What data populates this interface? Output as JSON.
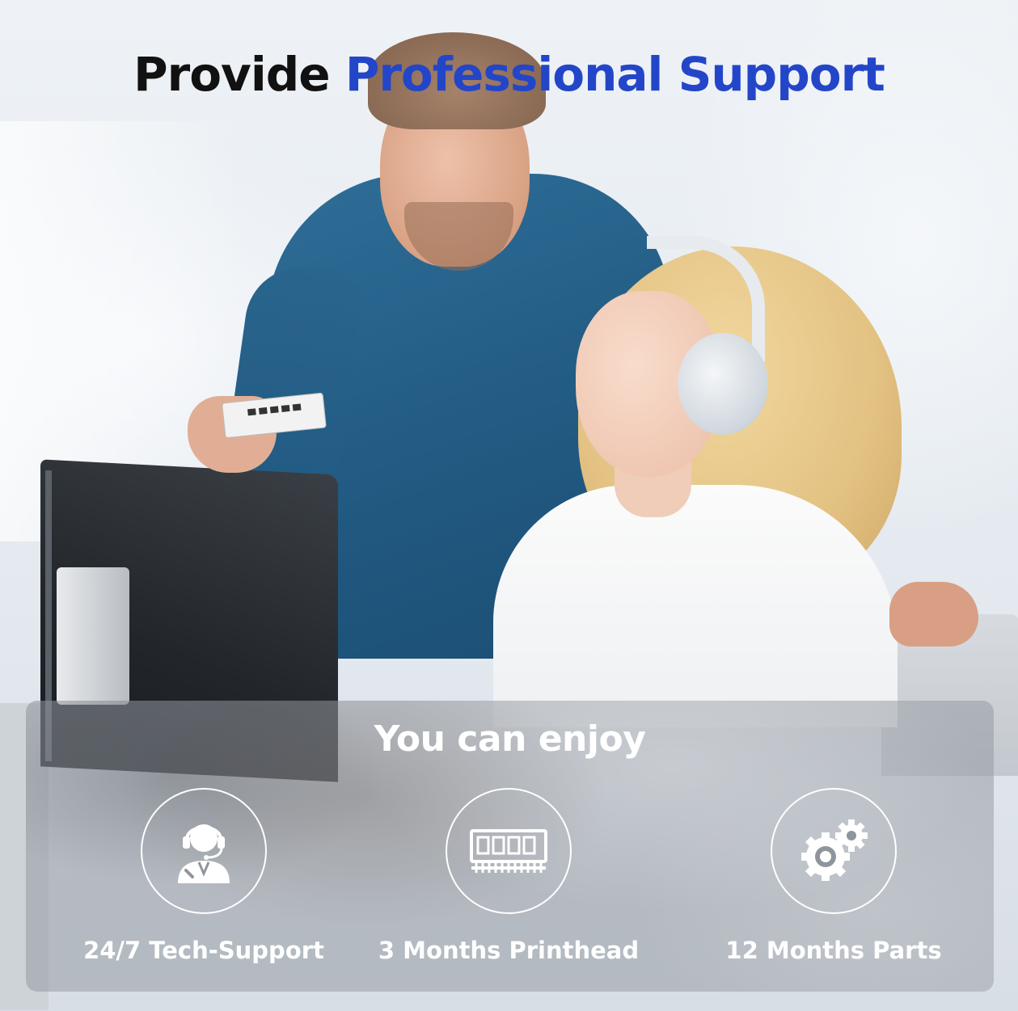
{
  "headline": {
    "lead": "Provide",
    "accent": "Professional Support"
  },
  "colors": {
    "accent": "#2346c9",
    "headline_text": "#111111",
    "panel_text": "#ffffff"
  },
  "panel": {
    "title": "You can enjoy",
    "features": [
      {
        "icon": "support-agent-icon",
        "label": "24/7 Tech-Support"
      },
      {
        "icon": "printhead-icon",
        "label": "3 Months Printhead"
      },
      {
        "icon": "gears-icon",
        "label": "12 Months Parts"
      }
    ]
  }
}
